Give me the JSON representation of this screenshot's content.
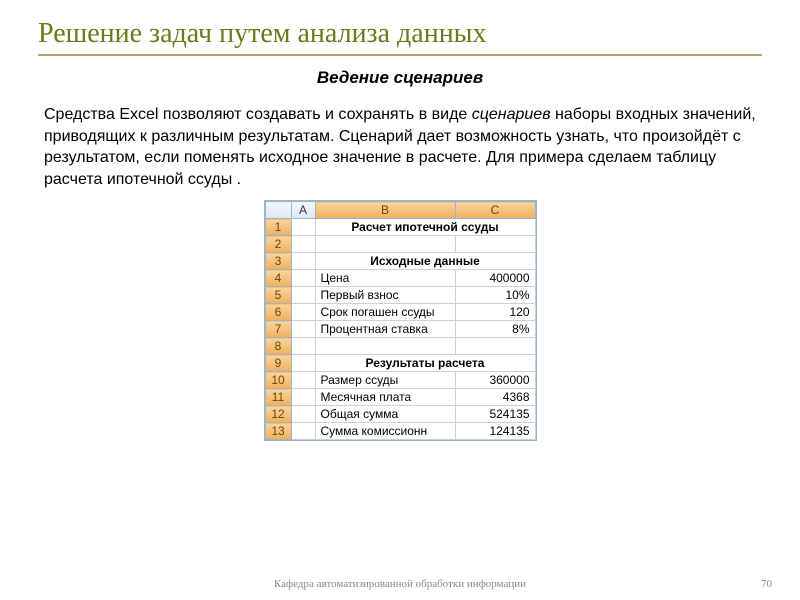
{
  "title": "Решение задач путем анализа данных",
  "subtitle": "Ведение сценариев",
  "paragraph_pre": "Средства Excel позволяют создавать и сохранять в виде ",
  "paragraph_em": "сценариев",
  "paragraph_post": " наборы входных значений, приводящих к различным результатам. Сценарий дает возможность узнать, что произойдёт с результатом, если поменять исходное значение в расчете. Для примера сделаем таблицу расчета ипотечной ссуды .",
  "excel": {
    "cols": [
      "A",
      "B",
      "C"
    ],
    "rows_header": [
      "1",
      "2",
      "3",
      "4",
      "5",
      "6",
      "7",
      "8",
      "9",
      "10",
      "11",
      "12",
      "13"
    ],
    "row1_merged": "Расчет ипотечной ссуды",
    "row3_section": "Исходные данные",
    "row4": {
      "b": "Цена",
      "c": "400000"
    },
    "row5": {
      "b": "Первый взнос",
      "c": "10%"
    },
    "row6": {
      "b": "Срок погашен ссуды",
      "c": "120"
    },
    "row7": {
      "b": "Процентная ставка",
      "c": "8%"
    },
    "row9_section": "Результаты расчета",
    "row10": {
      "b": "Размер ссуды",
      "c": "360000"
    },
    "row11": {
      "b": "Месячная плата",
      "c": "4368"
    },
    "row12": {
      "b": "Общая сумма",
      "c": "524135"
    },
    "row13": {
      "b": "Сумма  комиссионн",
      "c": "124135"
    }
  },
  "footer": "Кафедра автоматизированной обработки информации",
  "page": "70"
}
